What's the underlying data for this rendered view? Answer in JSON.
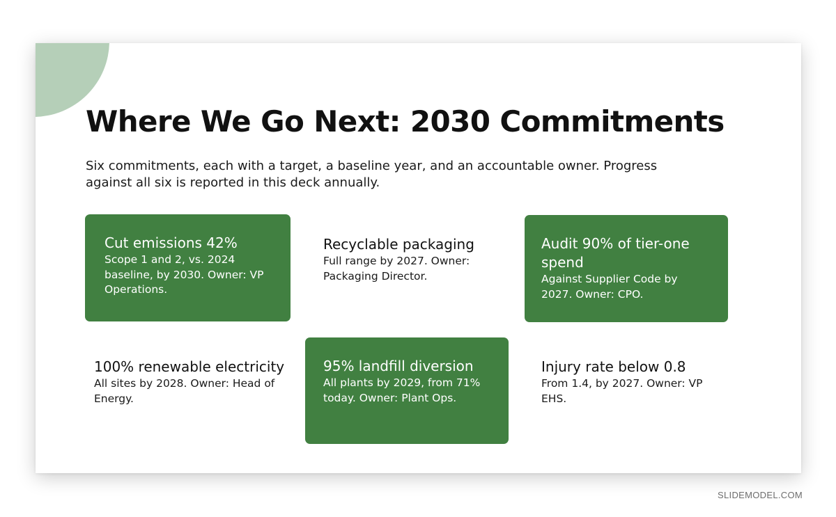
{
  "slide": {
    "title": "Where We Go Next: 2030 Commitments",
    "subtitle": "Six commitments, each with a target, a baseline year, and an accountable owner. Progress against all six is reported in this deck annually."
  },
  "commitments": [
    {
      "title": "Cut emissions 42%",
      "body": "Scope 1 and 2, vs. 2024 baseline, by 2030. Owner: VP Operations.",
      "style": "green"
    },
    {
      "title": "Recyclable packaging",
      "body": "Full range by 2027. Owner: Packaging Director.",
      "style": "plain"
    },
    {
      "title": "Audit 90% of tier-one spend",
      "body": "Against Supplier Code by 2027. Owner: CPO.",
      "style": "green"
    },
    {
      "title": "100% renewable electricity",
      "body": "All sites by 2028. Owner: Head of Energy.",
      "style": "plain"
    },
    {
      "title": "95% landfill diversion",
      "body": "All plants by 2029, from 71% today. Owner: Plant Ops.",
      "style": "green"
    },
    {
      "title": "Injury rate below 0.8",
      "body": "From 1.4, by 2027. Owner: VP EHS.",
      "style": "plain"
    }
  ],
  "colors": {
    "accent_green": "#418041",
    "corner_circle": "#b5cfb8",
    "title_text": "#111111"
  },
  "watermark": "SLIDEMODEL.COM"
}
